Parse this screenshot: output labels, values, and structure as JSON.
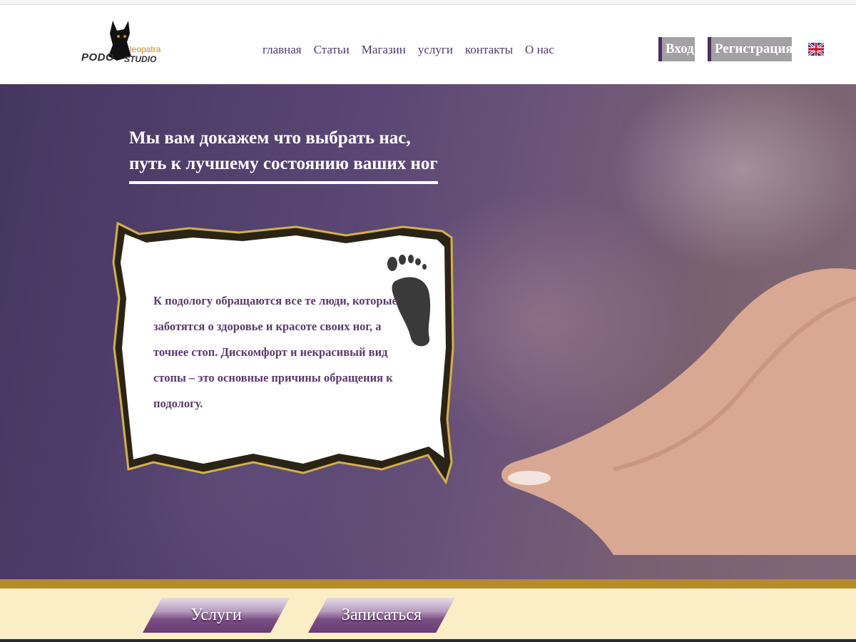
{
  "logo": {
    "text_podo": "PODO",
    "text_leopatra": "leopatra",
    "text_studio": "STUDIO"
  },
  "nav": {
    "items": [
      "главная",
      "Статьи",
      "Магазин",
      "услуги",
      "контакты",
      "О нас"
    ]
  },
  "auth": {
    "login_label": "Вход",
    "register_label": "Регистрация"
  },
  "language_icon": "uk-flag-icon",
  "hero": {
    "headline": "Мы вам докажем что выбрать нас, путь к лучшему состоянию ваших ног",
    "scroll_text": "К подологу обращаются все те люди, которые заботятся о здоровье и красоте своих ног, а точнее стоп. Дискомфорт и некрасивый вид стопы – это основные причины обращения к подологу."
  },
  "cta": {
    "services_label": "Услуги",
    "book_label": "Записаться"
  },
  "colors": {
    "brand_purple": "#4d2d5e",
    "gold": "#b48c2a",
    "band_cream": "#fbedc5",
    "auth_gray": "#a3a1a4"
  }
}
